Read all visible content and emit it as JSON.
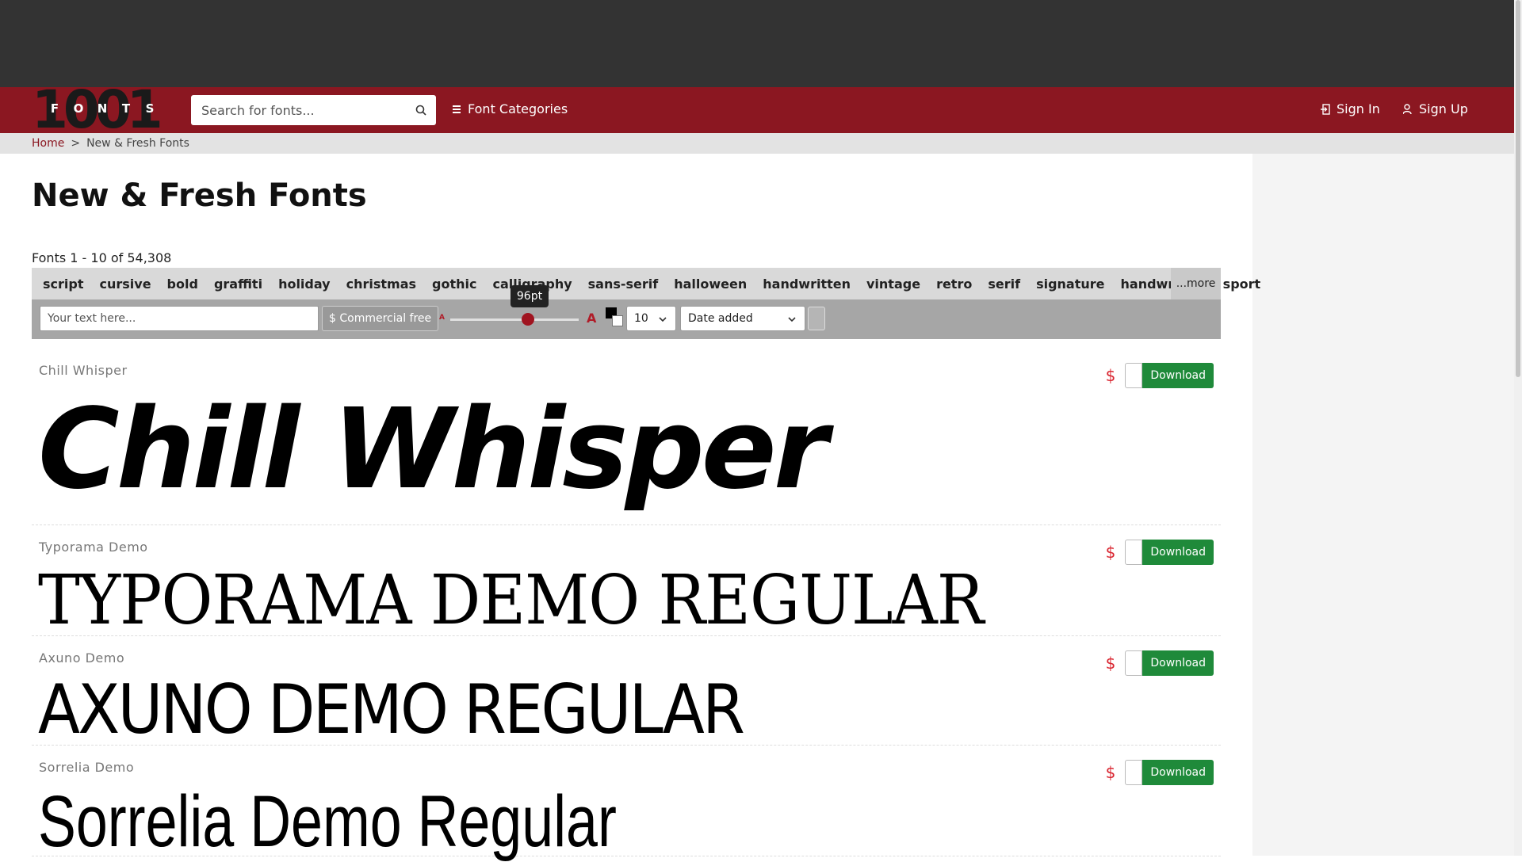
{
  "logo": {
    "digits": "1001",
    "letters": [
      "F",
      "O",
      "N",
      "T",
      "S"
    ]
  },
  "search": {
    "placeholder": "Search for fonts..."
  },
  "nav": {
    "font_categories": "Font Categories",
    "sign_in": "Sign In",
    "sign_up": "Sign Up"
  },
  "breadcrumb": {
    "home": "Home",
    "separator": ">",
    "current": "New & Fresh Fonts"
  },
  "page": {
    "title": "New & Fresh Fonts",
    "count": "Fonts 1 - 10 of 54,308"
  },
  "tags": [
    "script",
    "cursive",
    "bold",
    "graffiti",
    "holiday",
    "christmas",
    "gothic",
    "calligraphy",
    "sans-serif",
    "halloween",
    "handwritten",
    "vintage",
    "retro",
    "serif",
    "signature",
    "handwriting",
    "sport"
  ],
  "tags_more": "...more",
  "tools": {
    "text_placeholder": "Your text here...",
    "commercial_free": "$ Commercial free",
    "size_small": "A",
    "size_large": "A",
    "size_tooltip": "96pt",
    "size_value_pt": 96,
    "per_page": "10",
    "sort": "Date added"
  },
  "fonts": [
    {
      "name": "Chill Whisper",
      "preview": "Chill Whisper",
      "price_icon": "$",
      "download": "Download"
    },
    {
      "name": "Typorama Demo",
      "preview": "TYPORAMA DEMO REGULAR",
      "price_icon": "$",
      "download": "Download"
    },
    {
      "name": "Axuno Demo",
      "preview": "AXUNO DEMO REGULAR",
      "price_icon": "$",
      "download": "Download"
    },
    {
      "name": "Sorrelia Demo",
      "preview": "Sorrelia Demo Regular",
      "price_icon": "$",
      "download": "Download"
    }
  ],
  "colors": {
    "brand": "#8b1721",
    "header_bg": "#333333",
    "download_green": "#1f8a3a",
    "price_red": "#d9242f"
  }
}
